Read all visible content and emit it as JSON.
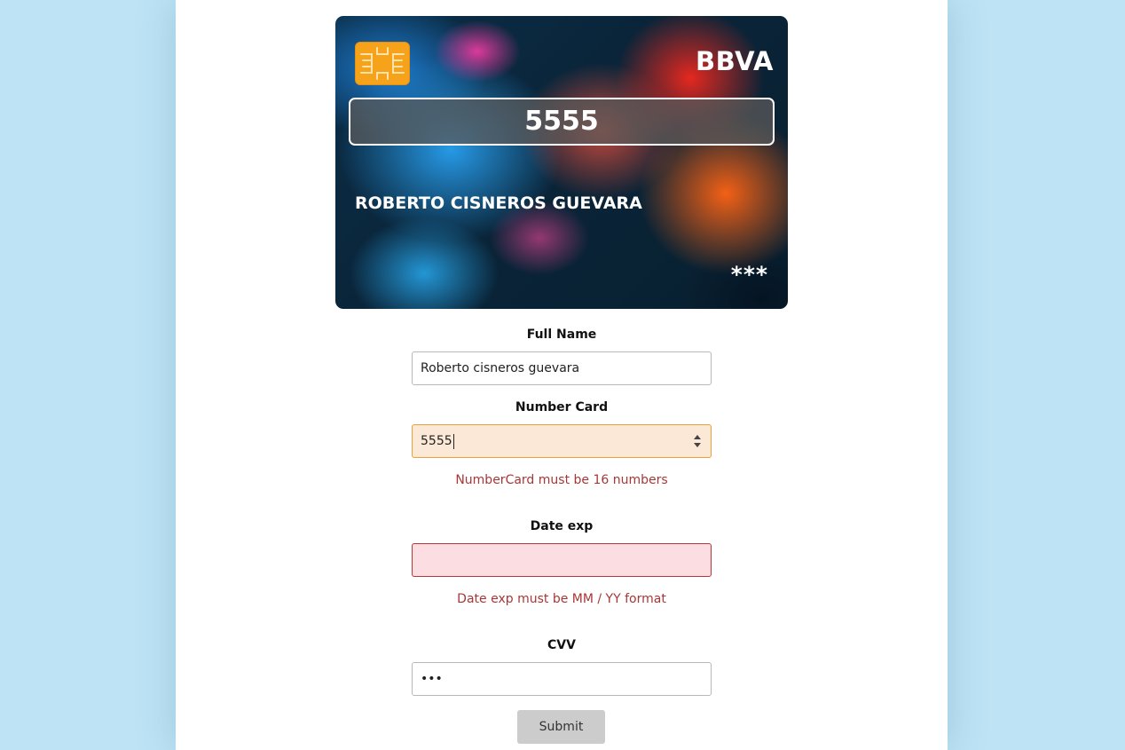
{
  "card": {
    "bank": "BBVA",
    "number": "5555",
    "holder": "ROBERTO CISNEROS GUEVARA",
    "cvv_mask": "***",
    "chip_color": "#f6a21a"
  },
  "form": {
    "full_name": {
      "label": "Full Name",
      "value": "Roberto cisneros guevara"
    },
    "number_card": {
      "label": "Number Card",
      "value": "5555",
      "error": "NumberCard must be 16 numbers"
    },
    "date_exp": {
      "label": "Date exp",
      "value": "",
      "error": "Date exp must be MM / YY format"
    },
    "cvv": {
      "label": "CVV",
      "value": "•••"
    },
    "submit_label": "Submit"
  },
  "colors": {
    "background": "#bde3f5",
    "error_text": "#a93636",
    "focus_fill": "#fbe8d6",
    "invalid_fill": "#fcdde1"
  }
}
